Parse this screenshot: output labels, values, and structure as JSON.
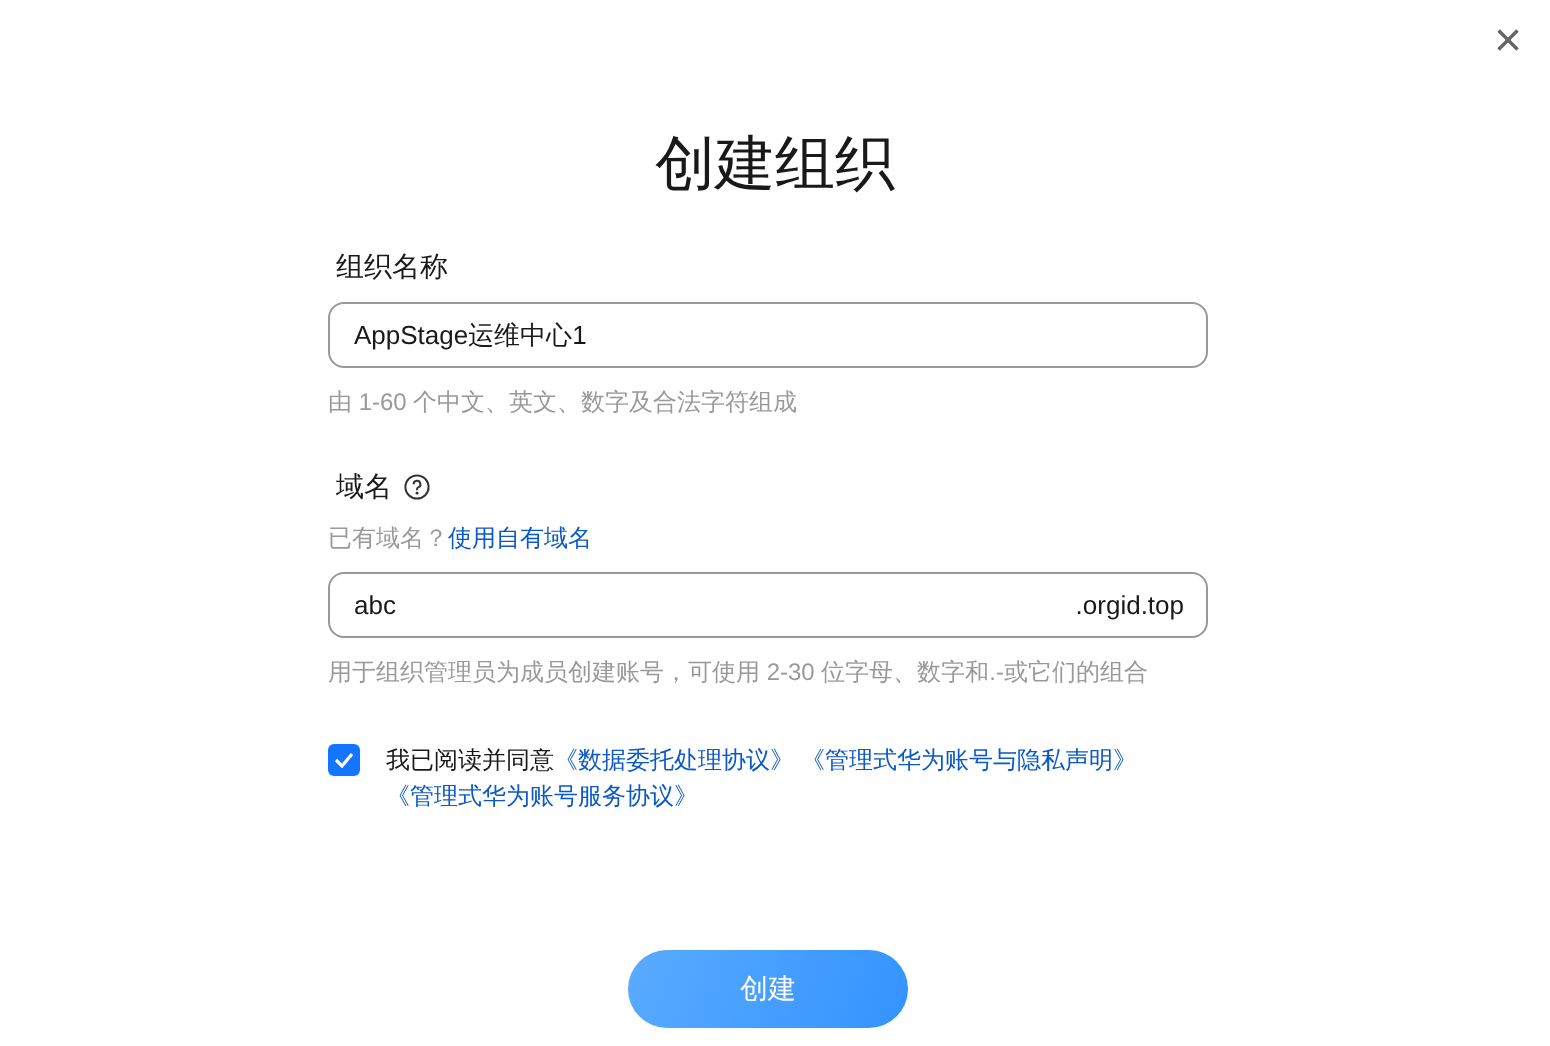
{
  "dialog": {
    "title": "创建组织",
    "close_icon": "×"
  },
  "org_name": {
    "label": "组织名称",
    "value": "AppStage运维中心1",
    "hint": "由 1-60 个中文、英文、数字及合法字符组成"
  },
  "domain": {
    "label": "域名",
    "prompt": "已有域名？",
    "link": "使用自有域名",
    "value": "abc",
    "suffix": ".orgid.top",
    "hint": "用于组织管理员为成员创建账号，可使用 2-30 位字母、数字和.-或它们的组合"
  },
  "agreement": {
    "checked": true,
    "text": "我已阅读并同意",
    "links": [
      "《数据委托处理协议》",
      "《管理式华为账号与隐私声明》",
      "《管理式华为账号服务协议》"
    ]
  },
  "button": {
    "label": "创建"
  }
}
